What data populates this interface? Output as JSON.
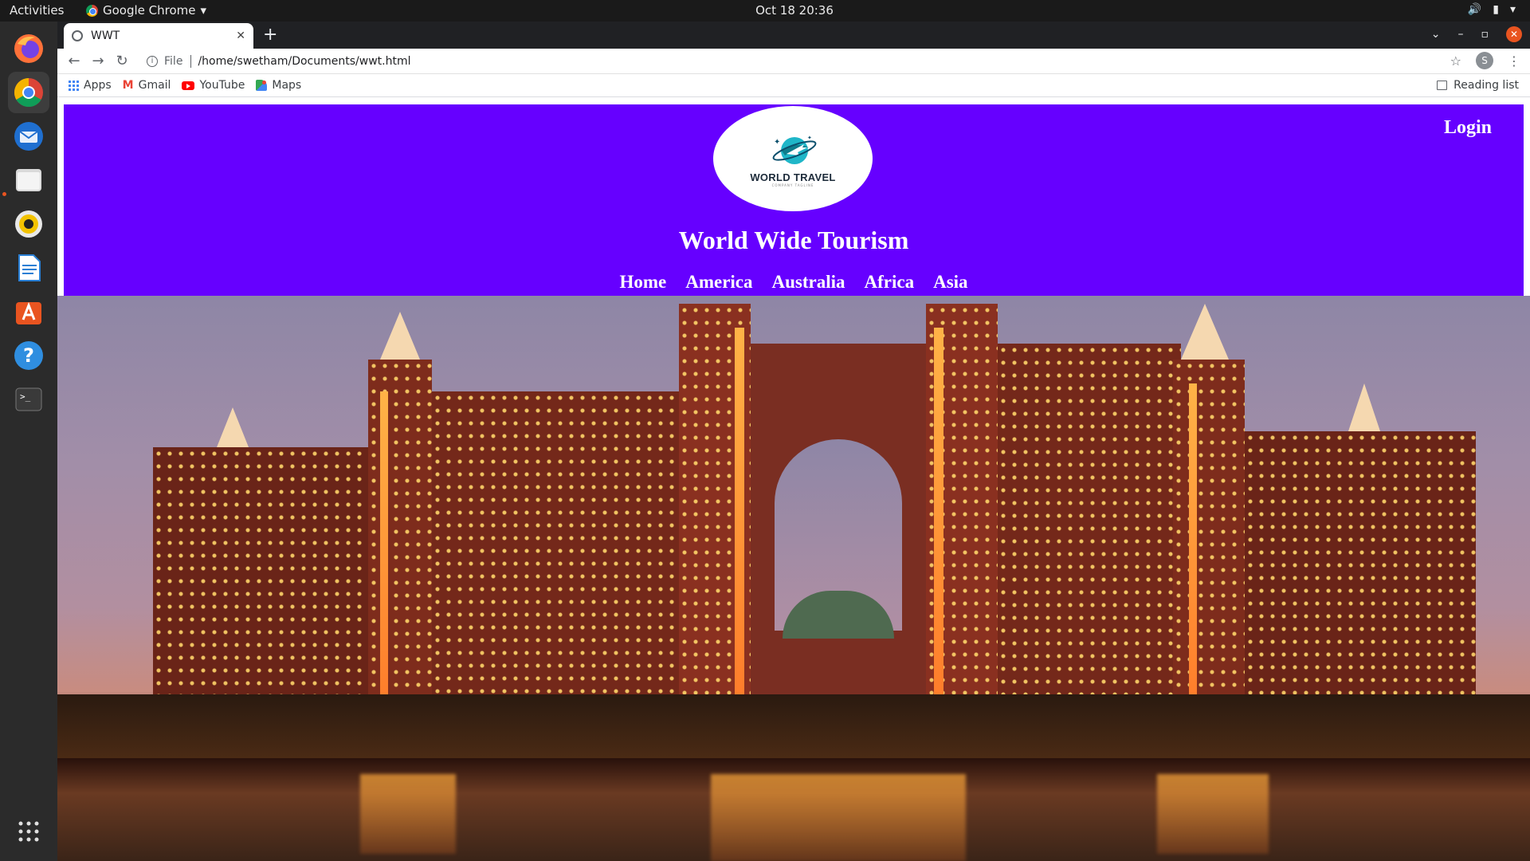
{
  "system": {
    "activities": "Activities",
    "app_name": "Google Chrome",
    "clock": "Oct 18  20:36"
  },
  "browser": {
    "tab_title": "WWT",
    "scheme_label": "File",
    "url": "/home/swetham/Documents/wwt.html",
    "profile_initial": "S",
    "bookmarks": [
      {
        "label": "Apps",
        "icon": "apps-grid-icon"
      },
      {
        "label": "Gmail",
        "icon": "gmail-icon"
      },
      {
        "label": "YouTube",
        "icon": "youtube-icon"
      },
      {
        "label": "Maps",
        "icon": "maps-icon"
      }
    ],
    "reading_list": "Reading list"
  },
  "dock": {
    "apps": [
      "Firefox",
      "Google Chrome",
      "Thunderbird",
      "Files",
      "Rhythmbox",
      "LibreOffice Writer",
      "Ubuntu Software",
      "Help",
      "Terminal"
    ]
  },
  "site": {
    "header_color": "#6600ff",
    "logo_text": "WORLD TRAVEL",
    "logo_subtext": "COMPANY TAGLINE",
    "login": "Login",
    "title": "World Wide Tourism",
    "nav": [
      "Home",
      "America",
      "Australia",
      "Africa",
      "Asia"
    ]
  }
}
